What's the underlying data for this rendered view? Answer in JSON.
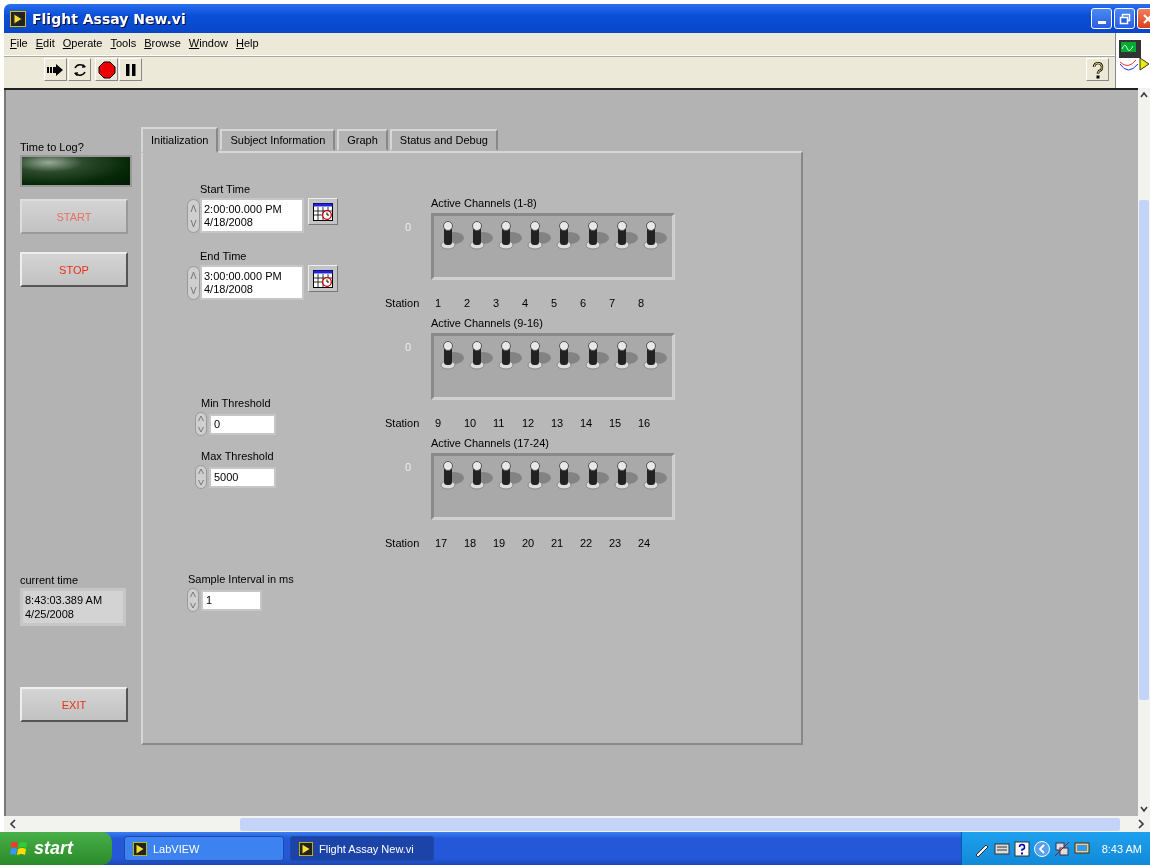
{
  "window": {
    "title": "Flight Assay New.vi"
  },
  "menu": [
    "File",
    "Edit",
    "Operate",
    "Tools",
    "Browse",
    "Window",
    "Help"
  ],
  "left": {
    "log_label": "Time to Log?",
    "log_on": false,
    "buttons": [
      {
        "label": "START",
        "disabled": true
      },
      {
        "label": "STOP",
        "disabled": false
      }
    ],
    "time_label": "current time",
    "time_value": [
      "8:43:03.389 AM",
      "4/25/2008"
    ],
    "exit": {
      "label": "EXIT",
      "disabled": false
    }
  },
  "tabs": [
    {
      "label": "Initialization",
      "selected": true
    },
    {
      "label": "Subject Information",
      "selected": false
    },
    {
      "label": "Graph",
      "selected": false
    },
    {
      "label": "Status and Debug",
      "selected": false
    }
  ],
  "times": [
    {
      "label": "Start Time",
      "value": [
        "2:00:00.000 PM",
        "4/18/2008"
      ]
    },
    {
      "label": "End Time",
      "value": [
        "3:00:00.000 PM",
        "4/18/2008"
      ]
    }
  ],
  "numerics": [
    {
      "label": "Min Threshold",
      "value": "0"
    },
    {
      "label": "Max Threshold",
      "value": "5000"
    },
    {
      "label": "Sample Interval in ms",
      "value": "1"
    }
  ],
  "channel_groups": [
    {
      "label": "Active Channels (1-8)",
      "zero": "0",
      "station_label": "Station",
      "stations": [
        "1",
        "2",
        "3",
        "4",
        "5",
        "6",
        "7",
        "8"
      ],
      "switches": [
        {
          "on": false
        },
        {
          "on": false
        },
        {
          "on": false
        },
        {
          "on": false
        },
        {
          "on": false
        },
        {
          "on": false
        },
        {
          "on": false
        },
        {
          "on": false
        }
      ]
    },
    {
      "label": "Active Channels (9-16)",
      "zero": "0",
      "station_label": "Station",
      "stations": [
        "9",
        "10",
        "11",
        "12",
        "13",
        "14",
        "15",
        "16"
      ],
      "switches": [
        {
          "on": false
        },
        {
          "on": false
        },
        {
          "on": false
        },
        {
          "on": false
        },
        {
          "on": false
        },
        {
          "on": false
        },
        {
          "on": false
        },
        {
          "on": false
        }
      ]
    },
    {
      "label": "Active Channels  (17-24)",
      "zero": "0",
      "station_label": "Station",
      "stations": [
        "17",
        "18",
        "19",
        "20",
        "21",
        "22",
        "23",
        "24"
      ],
      "switches": [
        {
          "on": false
        },
        {
          "on": false
        },
        {
          "on": false
        },
        {
          "on": false
        },
        {
          "on": false
        },
        {
          "on": false
        },
        {
          "on": false
        },
        {
          "on": false
        }
      ]
    }
  ],
  "taskbar": {
    "start": "start",
    "tasks": [
      {
        "label": "LabVIEW",
        "selected": false
      },
      {
        "label": "Flight Assay New.vi",
        "selected": true
      }
    ],
    "clock": "8:43 AM"
  }
}
